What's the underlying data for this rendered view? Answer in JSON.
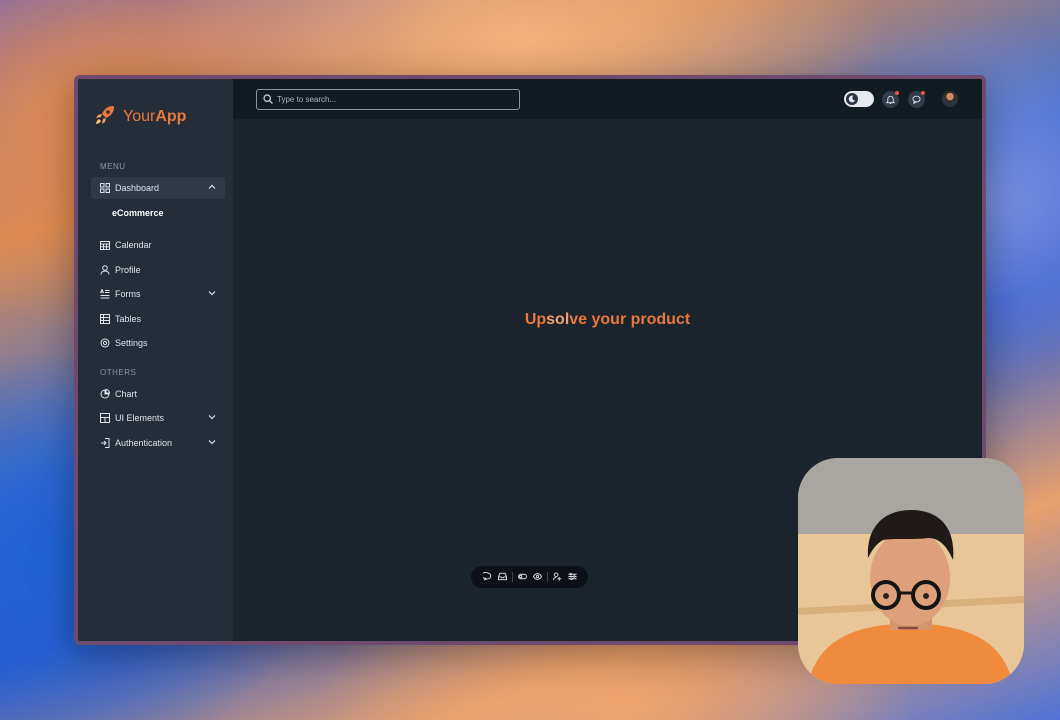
{
  "app": {
    "logo_text_regular": "Your",
    "logo_text_bold": "App",
    "brand_color": "#E8783B"
  },
  "sidebar": {
    "menu_label": "MENU",
    "others_label": "OTHERS",
    "menu_items": [
      {
        "label": "Dashboard",
        "icon": "grid-icon",
        "expanded": true,
        "active": true,
        "children": [
          {
            "label": "eCommerce"
          }
        ]
      },
      {
        "label": "Calendar",
        "icon": "calendar-icon"
      },
      {
        "label": "Profile",
        "icon": "user-icon"
      },
      {
        "label": "Forms",
        "icon": "forms-icon",
        "expanded": false
      },
      {
        "label": "Tables",
        "icon": "table-icon"
      },
      {
        "label": "Settings",
        "icon": "gear-icon"
      }
    ],
    "other_items": [
      {
        "label": "Chart",
        "icon": "pie-chart-icon"
      },
      {
        "label": "UI Elements",
        "icon": "layout-icon",
        "expanded": false
      },
      {
        "label": "Authentication",
        "icon": "login-icon",
        "expanded": false
      }
    ]
  },
  "header": {
    "search_placeholder": "Type to search...",
    "theme_toggle": "dark-mode",
    "notification_badge_color": "#E8564A"
  },
  "main": {
    "headline_part1": "Up",
    "headline_highlight": "sol",
    "headline_part2": "ve your product"
  },
  "toolbar": {
    "buttons": [
      "comment-icon",
      "inbox-icon",
      "toggle-icon",
      "eye-icon",
      "user-settings-icon",
      "sliders-icon"
    ]
  }
}
